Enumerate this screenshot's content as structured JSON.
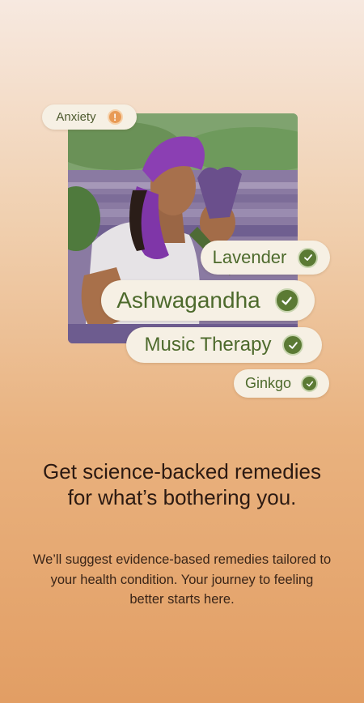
{
  "tags": {
    "anxiety": "Anxiety",
    "lavender": "Lavender",
    "ashwagandha": "Ashwagandha",
    "music_therapy": "Music Therapy",
    "ginkgo": "Ginkgo"
  },
  "icons": {
    "warning": "exclamation-icon",
    "check": "check-icon"
  },
  "content": {
    "headline": "Get science-backed remedies for what’s bothering you.",
    "subtext": "We’ll suggest evidence-based remedies tailored to your health condition. Your journey to feeling better starts here."
  },
  "colors": {
    "accent_green": "#5b7a34",
    "warning_orange": "#e89a55",
    "chip_bg": "#f6f0e4"
  }
}
